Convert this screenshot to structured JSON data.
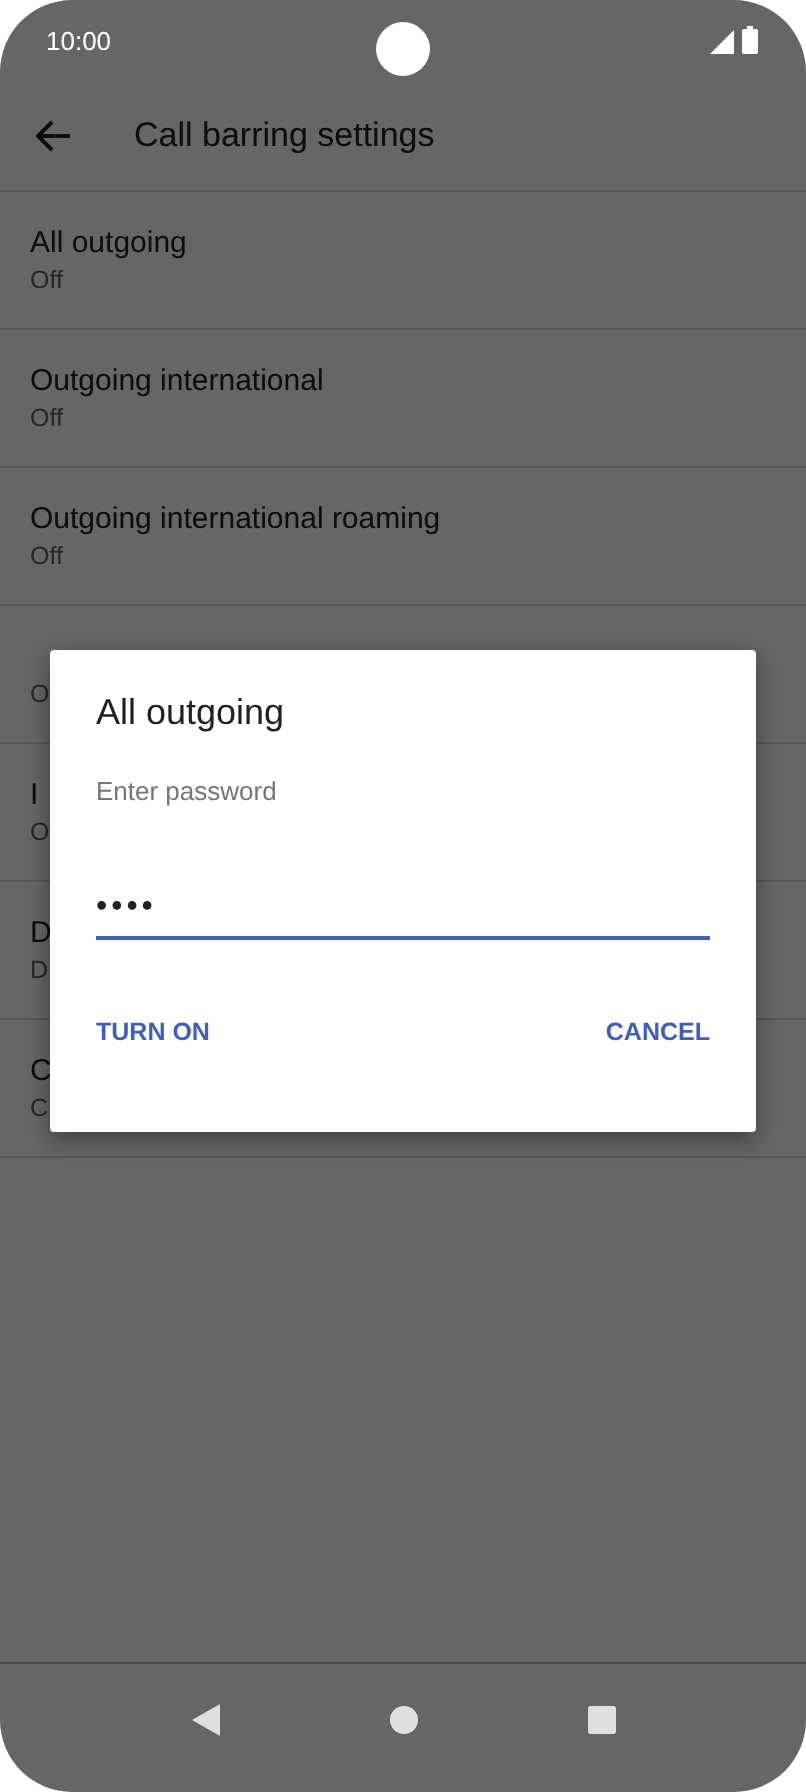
{
  "status_bar": {
    "time": "10:00"
  },
  "toolbar": {
    "title": "Call barring settings"
  },
  "settings": [
    {
      "title": "All outgoing",
      "summary": "Off"
    },
    {
      "title": "Outgoing international",
      "summary": "Off"
    },
    {
      "title": "Outgoing international roaming",
      "summary": "Off"
    },
    {
      "summary": "O"
    },
    {
      "title": "I",
      "summary": "O"
    },
    {
      "title": "D",
      "summary": "D"
    },
    {
      "title": "C",
      "summary": "C"
    }
  ],
  "dialog": {
    "title": "All outgoing",
    "message": "Enter password",
    "field": {
      "value": "••••"
    },
    "buttons": [
      {
        "label": "TURN ON",
        "kind": "confirm"
      },
      {
        "label": "CANCEL",
        "kind": "dismiss"
      }
    ]
  }
}
